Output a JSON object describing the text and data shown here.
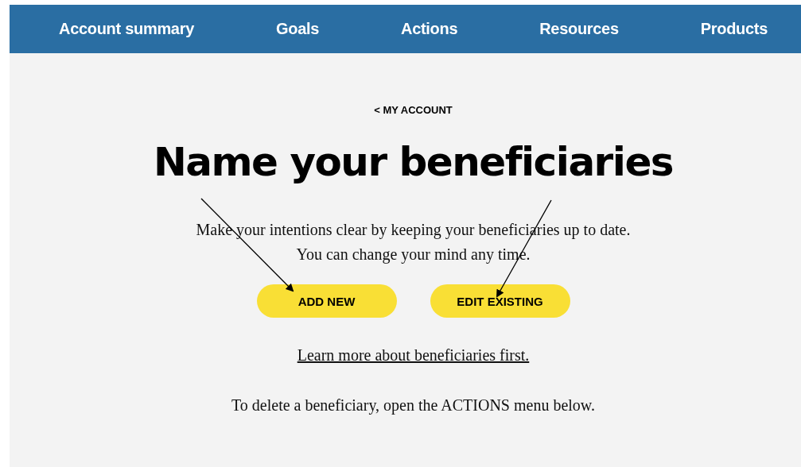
{
  "nav": [
    {
      "label": "Account summary"
    },
    {
      "label": "Goals"
    },
    {
      "label": "Actions"
    },
    {
      "label": "Resources"
    },
    {
      "label": "Products"
    }
  ],
  "back_link": "< MY ACCOUNT",
  "title": "Name your beneficiaries",
  "intro": [
    "Make your intentions clear by keeping your beneficiaries up to date.",
    "You can change your mind any time."
  ],
  "buttons": [
    {
      "label": "ADD NEW"
    },
    {
      "label": "EDIT EXISTING"
    }
  ],
  "learn_link": "Learn more about beneficiaries first.",
  "note": "To delete a beneficiary, open the ACTIONS menu below."
}
